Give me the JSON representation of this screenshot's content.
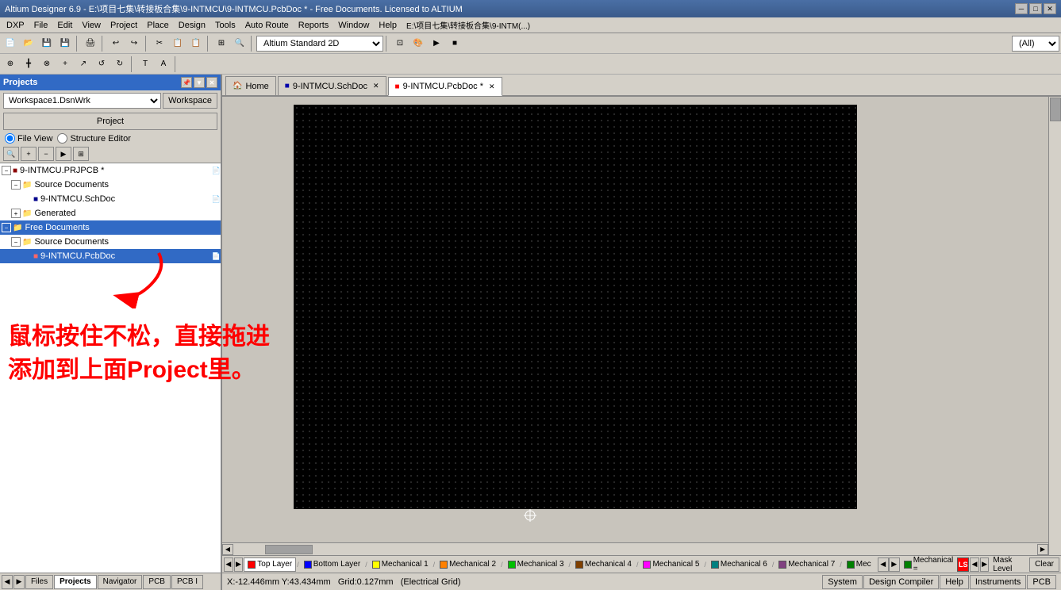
{
  "window": {
    "title": "Altium Designer 6.9 - E:\\项目七集\\转接板合集\\9-INTMCU\\9-INTMCU.PcbDoc * - Free Documents. Licensed to ALTIUM"
  },
  "menubar": {
    "items": [
      "DXP",
      "File",
      "Edit",
      "View",
      "Project",
      "Place",
      "Design",
      "Tools",
      "Auto Route",
      "Reports",
      "Window",
      "Help",
      "E:\\项目七集\\转接板合集\\9-INTM(..."
    ]
  },
  "toolbar1": {
    "view_label": "Altium Standard 2D",
    "all_label": "(All)"
  },
  "tabs": {
    "home": "Home",
    "schDoc": "9-INTMCU.SchDoc",
    "pcbDoc": "9-INTMCU.PcbDoc *"
  },
  "sidebar": {
    "title": "Projects",
    "workspace_value": "Workspace1.DsnWrk",
    "workspace_btn": "Workspace",
    "project_btn": "Project",
    "view_file": "File View",
    "view_structure": "Structure Editor",
    "tree": [
      {
        "level": 0,
        "expanded": true,
        "label": "9-INTMCU.PRJPCB *",
        "icon": "pcb-project"
      },
      {
        "level": 1,
        "expanded": true,
        "label": "Source Documents",
        "icon": "folder"
      },
      {
        "level": 2,
        "expanded": false,
        "label": "9-INTMCU.SchDoc",
        "icon": "sch"
      },
      {
        "level": 1,
        "expanded": false,
        "label": "Generated",
        "icon": "folder"
      },
      {
        "level": 0,
        "expanded": true,
        "label": "Free Documents",
        "icon": "folder",
        "selected": false
      },
      {
        "level": 1,
        "expanded": true,
        "label": "Source Documents",
        "icon": "folder"
      },
      {
        "level": 2,
        "expanded": false,
        "label": "9-INTMCU.PcbDoc",
        "icon": "pcb",
        "selected": true
      }
    ]
  },
  "annotation": {
    "line1": "鼠标按住不松，直接拖进",
    "line2": "添加到上面Project里。"
  },
  "layers": [
    {
      "label": "Top Layer",
      "color": "#ff0000",
      "active": true
    },
    {
      "label": "Bottom Layer",
      "color": "#0000ff",
      "active": false
    },
    {
      "label": "Mechanical 1",
      "color": "#ffff00",
      "active": false
    },
    {
      "label": "Mechanical 2",
      "color": "#ff8000",
      "active": false
    },
    {
      "label": "Mechanical 3",
      "color": "#00ff00",
      "active": false
    },
    {
      "label": "Mechanical 4",
      "color": "#804000",
      "active": false
    },
    {
      "label": "Mechanical 5",
      "color": "#ff00ff",
      "active": false
    },
    {
      "label": "Mechanical 6",
      "color": "#008080",
      "active": false
    },
    {
      "label": "Mechanical 7",
      "color": "#804080",
      "active": false
    },
    {
      "label": "Mec...",
      "color": "#008000",
      "active": false
    }
  ],
  "statusbar": {
    "coords": "X:-12.446mm Y:43.434mm",
    "grid": "Grid:0.127mm",
    "electrical": "(Electrical Grid)",
    "system_btn": "System",
    "design_compiler_btn": "Design Compiler",
    "help_btn": "Help",
    "instruments_btn": "Instruments",
    "pcb_btn": "PCB"
  },
  "panel_tabs": {
    "items": [
      "Files",
      "Projects",
      "Navigator",
      "PCB",
      "PCB I"
    ]
  },
  "layer_controls": {
    "clear_btn": "Clear",
    "mask_label": "Mask Level"
  }
}
